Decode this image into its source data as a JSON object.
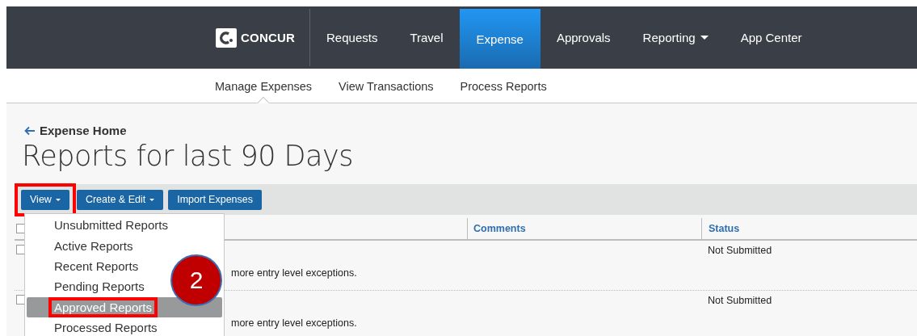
{
  "nav": {
    "logo": "CONCUR",
    "items": [
      {
        "label": "Requests",
        "selected": false,
        "has_menu": false
      },
      {
        "label": "Travel",
        "selected": false,
        "has_menu": false
      },
      {
        "label": "Expense",
        "selected": true,
        "has_menu": false
      },
      {
        "label": "Approvals",
        "selected": false,
        "has_menu": false
      },
      {
        "label": "Reporting",
        "selected": false,
        "has_menu": true
      },
      {
        "label": "App Center",
        "selected": false,
        "has_menu": false
      }
    ]
  },
  "subnav": [
    {
      "label": "Manage Expenses",
      "selected": true
    },
    {
      "label": "View Transactions",
      "selected": false
    },
    {
      "label": "Process Reports",
      "selected": false
    }
  ],
  "back_link": "Expense Home",
  "title": "Reports for last 90 Days",
  "toolbar": [
    {
      "label": "View",
      "has_menu": true,
      "highlighted": true
    },
    {
      "label": "Create & Edit",
      "has_menu": true,
      "highlighted": false
    },
    {
      "label": "Import Expenses",
      "has_menu": false,
      "highlighted": false
    }
  ],
  "table": {
    "columns": [
      "Comments",
      "Status"
    ],
    "header_checked": false,
    "rows": [
      {
        "checked": false,
        "exception": "more entry level exceptions.",
        "status": "Not Submitted"
      },
      {
        "checked": false,
        "exception": "more entry level exceptions.",
        "status": "Not Submitted"
      }
    ]
  },
  "menu": {
    "items": [
      {
        "label": "Unsubmitted Reports",
        "selected": false,
        "highlighted": false
      },
      {
        "label": "Active Reports",
        "selected": false,
        "highlighted": false
      },
      {
        "label": "Recent Reports",
        "selected": false,
        "highlighted": false
      },
      {
        "label": "Pending Reports",
        "selected": false,
        "highlighted": false
      },
      {
        "label": "Approved Reports",
        "selected": true,
        "highlighted": true
      },
      {
        "label": "Processed Reports",
        "selected": false,
        "highlighted": false
      }
    ]
  },
  "step_badge": "2"
}
